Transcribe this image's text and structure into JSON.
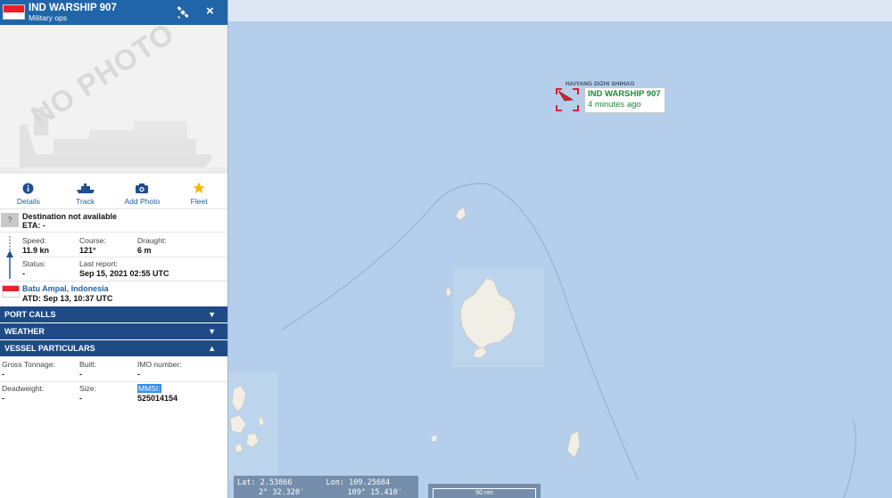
{
  "vessel": {
    "name": "IND WARSHIP 907",
    "type": "Military ops",
    "photo_placeholder": "NO PHOTO",
    "flag_colors": [
      "#e8202b",
      "#ffffff"
    ]
  },
  "actions": [
    {
      "label": "Details",
      "icon": "info-icon"
    },
    {
      "label": "Track",
      "icon": "ship-track-icon"
    },
    {
      "label": "Add Photo",
      "icon": "camera-icon"
    },
    {
      "label": "Fleet",
      "icon": "star-icon"
    }
  ],
  "destination": {
    "icon_text": "?",
    "text": "Destination not available",
    "eta": "ETA: -"
  },
  "voyage": {
    "speed_label": "Speed:",
    "speed": "11.9 kn",
    "course_label": "Course:",
    "course": "121°",
    "draught_label": "Draught:",
    "draught": "6 m",
    "status_label": "Status:",
    "status": "-",
    "last_report_label": "Last report:",
    "last_report": "Sep 15, 2021 02:55 UTC"
  },
  "last_port": {
    "name": "Batu Ampal, Indonesia",
    "atd": "ATD: Sep 13, 10:37 UTC"
  },
  "sections": [
    {
      "label": "PORT CALLS",
      "state": "collapsed"
    },
    {
      "label": "WEATHER",
      "state": "collapsed"
    },
    {
      "label": "VESSEL PARTICULARS",
      "state": "expanded"
    }
  ],
  "particulars": {
    "gross_tonnage_label": "Gross Tonnage:",
    "gross_tonnage": "-",
    "built_label": "Built:",
    "built": "-",
    "imo_label": "IMO number:",
    "imo": "-",
    "deadweight_label": "Deadweight:",
    "deadweight": "-",
    "size_label": "Size:",
    "size": "-",
    "mmsi_label": "MMSI:",
    "mmsi": "525014154"
  },
  "map": {
    "ship_label": "IND WARSHIP 907",
    "ship_age": "4 minutes ago",
    "other_vessel_label": "HAIYANG DIZHI SHIHAO",
    "lat_label": "Lat:",
    "lat": "2.53866",
    "lon_label": "Lon:",
    "lon": "109.25684",
    "lat_dms": "2° 32.320′",
    "lon_dms": "109° 15.410′",
    "scale": "50 nm",
    "colors": {
      "sea": "#b4ceeb",
      "land": "#f1eee6",
      "panel_header": "#1f65a8",
      "section_bar": "#1e4b86",
      "ship_green": "#1a8a3a",
      "marker_red": "#d8232a"
    }
  }
}
